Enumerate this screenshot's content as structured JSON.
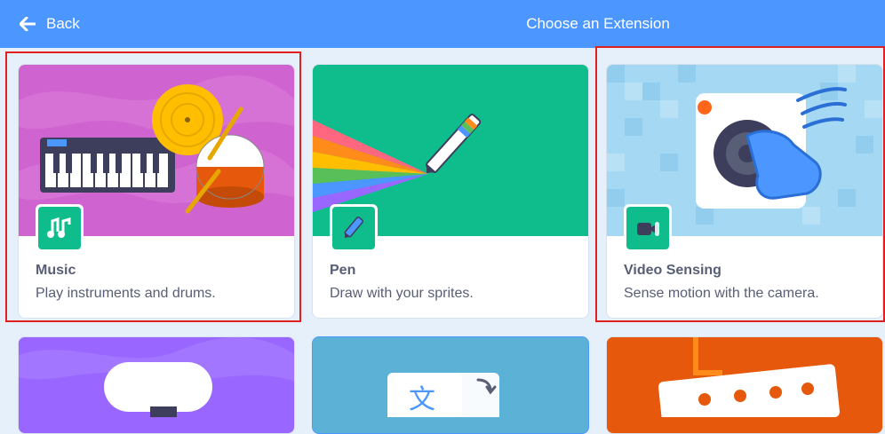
{
  "header": {
    "back_label": "Back",
    "title": "Choose an Extension"
  },
  "extensions": [
    {
      "name": "Music",
      "description": "Play instruments and drums.",
      "art_color": "#cf63cf",
      "badge_color": "#11b88b"
    },
    {
      "name": "Pen",
      "description": "Draw with your sprites.",
      "art_color": "#0fbd8c",
      "badge_color": "#0fbd8c"
    },
    {
      "name": "Video Sensing",
      "description": "Sense motion with the camera.",
      "art_color": "#a5d8f3",
      "badge_color": "#0fbd8c"
    }
  ],
  "extensions_row2": [
    {
      "art_color": "#9966ff"
    },
    {
      "art_color": "#5cb1d6"
    },
    {
      "art_color": "#e6580c"
    }
  ]
}
